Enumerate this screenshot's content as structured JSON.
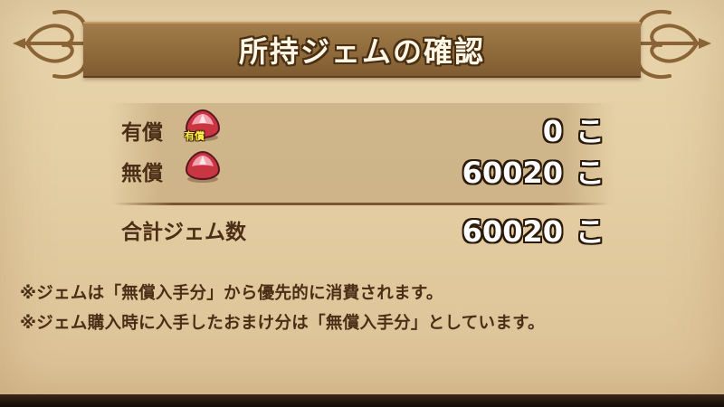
{
  "dialog": {
    "title": "所持ジェムの確認",
    "rows": [
      {
        "label": "有償",
        "gem_icon": "gem-icon",
        "gem_badge": "有償",
        "value": "0",
        "unit": "こ"
      },
      {
        "label": "無償",
        "gem_icon": "gem-icon",
        "value": "60020",
        "unit": "こ"
      }
    ],
    "total": {
      "label": "合計ジェム数",
      "value": "60020",
      "unit": "こ"
    },
    "notes": [
      "※ジェムは「無償入手分」から優先的に消費されます。",
      "※ジェム購入時に入手したおまけ分は「無償入手分」としています。"
    ]
  },
  "colors": {
    "parchment": "#e6d0a5",
    "banner": "#8f6a3b",
    "label_text": "#4a2e16",
    "value_text": "#ffffff",
    "gem_red": "#d8394a"
  }
}
